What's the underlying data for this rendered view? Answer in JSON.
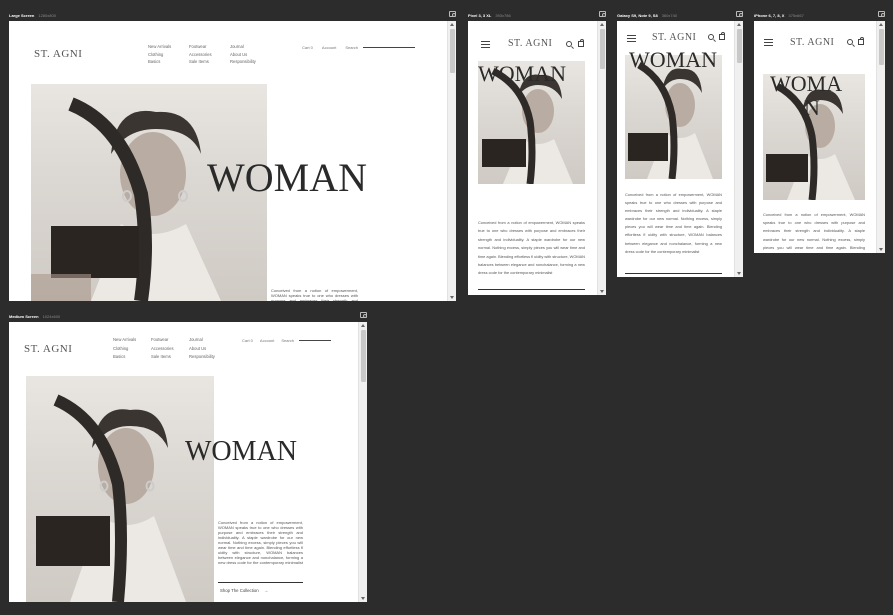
{
  "frames": {
    "large": {
      "name": "Large Screen",
      "size": "1280x800"
    },
    "medium": {
      "name": "Medium Screen",
      "size": "1024x600"
    },
    "pixel": {
      "name": "Pixel 3, 3 XL",
      "size": "393x786"
    },
    "galaxy": {
      "name": "Galaxy S9, Note 9, S8",
      "size": "360x740"
    },
    "iphone": {
      "name": "iPhone 6, 7, 8, X",
      "size": "375x667"
    }
  },
  "brand": "ST. AGNI",
  "nav": {
    "col1": [
      "New Arrivals",
      "Clothing",
      "Basics"
    ],
    "col2": [
      "Footwear",
      "Accessories",
      "Sale Items"
    ],
    "col3": [
      "Journal",
      "About Us",
      "Responsibility"
    ]
  },
  "util": {
    "cart": "Cart 0",
    "account": "Account",
    "search": "Search"
  },
  "hero": {
    "title": "WOMAN",
    "title_broken_a": "WOMA",
    "title_broken_b": "N",
    "copy": "Conceived from a notion of empowerment, WOMAN speaks true to one who dresses with purpose and embraces their strength and individuality. A staple wardrobe for our new normal. Nothing excess, simply pieces you will wear time and time again. Blending effortless fl uidity with structure, WOMAN balances between elegance and nonchalance, forming a new dress code for the contemporary minimalist",
    "copy_short": "Conceived from a notion of empowerment, WOMAN speaks true to one who dresses with purpose and embraces their strength and individuality.",
    "copy_iphone": "Conceived from a notion of empowerment, WOMAN speaks true to one who dresses with purpose and embraces their strength and individuality. A staple wardrobe for our new normal. Nothing excess, simply pieces you will wear time and time again. Blending effortless fl",
    "cta": "Shop The Collection",
    "cta_arrow": "→"
  },
  "colors": {
    "canvas": "#2c2c2c",
    "page": "#ffffff",
    "text": "#2a2a2a",
    "photo": "#dcd8d3"
  }
}
